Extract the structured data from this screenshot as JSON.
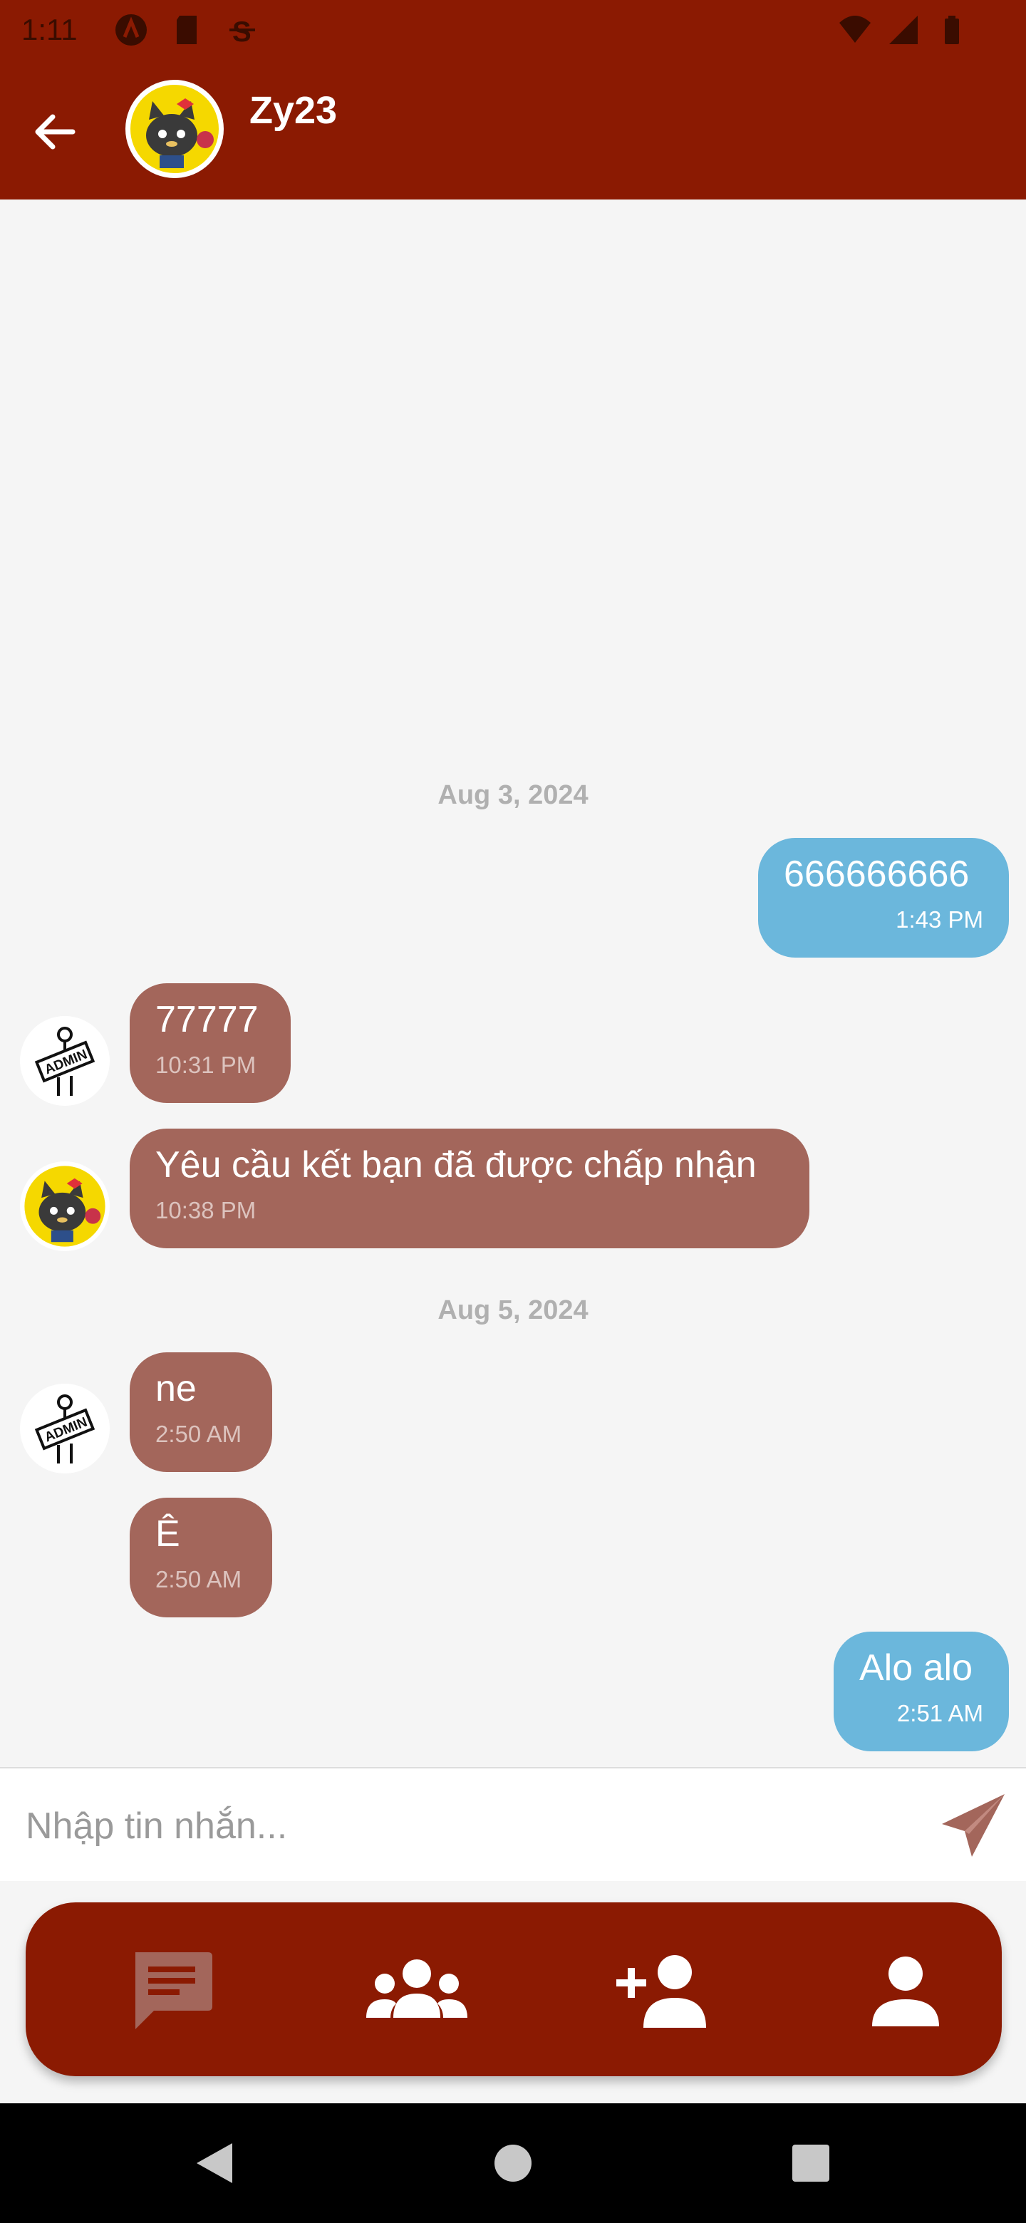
{
  "status_bar": {
    "time": "1:11",
    "icons_left": [
      "app-a-icon",
      "sd-card-icon",
      "strike-s-icon"
    ],
    "icons_right": [
      "wifi-icon",
      "signal-icon",
      "battery-icon"
    ]
  },
  "header": {
    "title": "Zy23",
    "back_icon": "arrow-left-icon",
    "avatar": "black-cat-avatar"
  },
  "colors": {
    "primary": "#8b1a02",
    "outgoing_bubble": "#6bb7dc",
    "incoming_bubble": "#a3665b",
    "background": "#f5f5f5"
  },
  "messages": {
    "date1": "Aug 3, 2024",
    "m1": {
      "text": "666666666",
      "time": "1:43 PM",
      "direction": "out"
    },
    "m2": {
      "text": "77777",
      "time": "10:31 PM",
      "direction": "in",
      "avatar": "admin-avatar"
    },
    "m3": {
      "text": "Yêu cầu kết bạn đã được chấp nhận",
      "time": "10:38 PM",
      "direction": "in",
      "avatar": "black-cat-avatar"
    },
    "date2": "Aug 5, 2024",
    "m4": {
      "text": "ne",
      "time": "2:50 AM",
      "direction": "in",
      "avatar": "admin-avatar"
    },
    "m5": {
      "text": "Ê",
      "time": "2:50 AM",
      "direction": "in"
    },
    "m6": {
      "text": "Alo alo",
      "time": "2:51 AM",
      "direction": "out"
    }
  },
  "input": {
    "placeholder": "Nhập tin nhắn...",
    "value": "",
    "send_icon": "send-icon"
  },
  "bottom_nav": {
    "items": [
      {
        "icon": "chat-icon",
        "active": true
      },
      {
        "icon": "groups-icon",
        "active": false
      },
      {
        "icon": "add-friend-icon",
        "active": false
      },
      {
        "icon": "profile-icon",
        "active": false
      }
    ]
  },
  "system_nav": [
    "back-triangle-icon",
    "home-circle-icon",
    "recents-square-icon"
  ]
}
